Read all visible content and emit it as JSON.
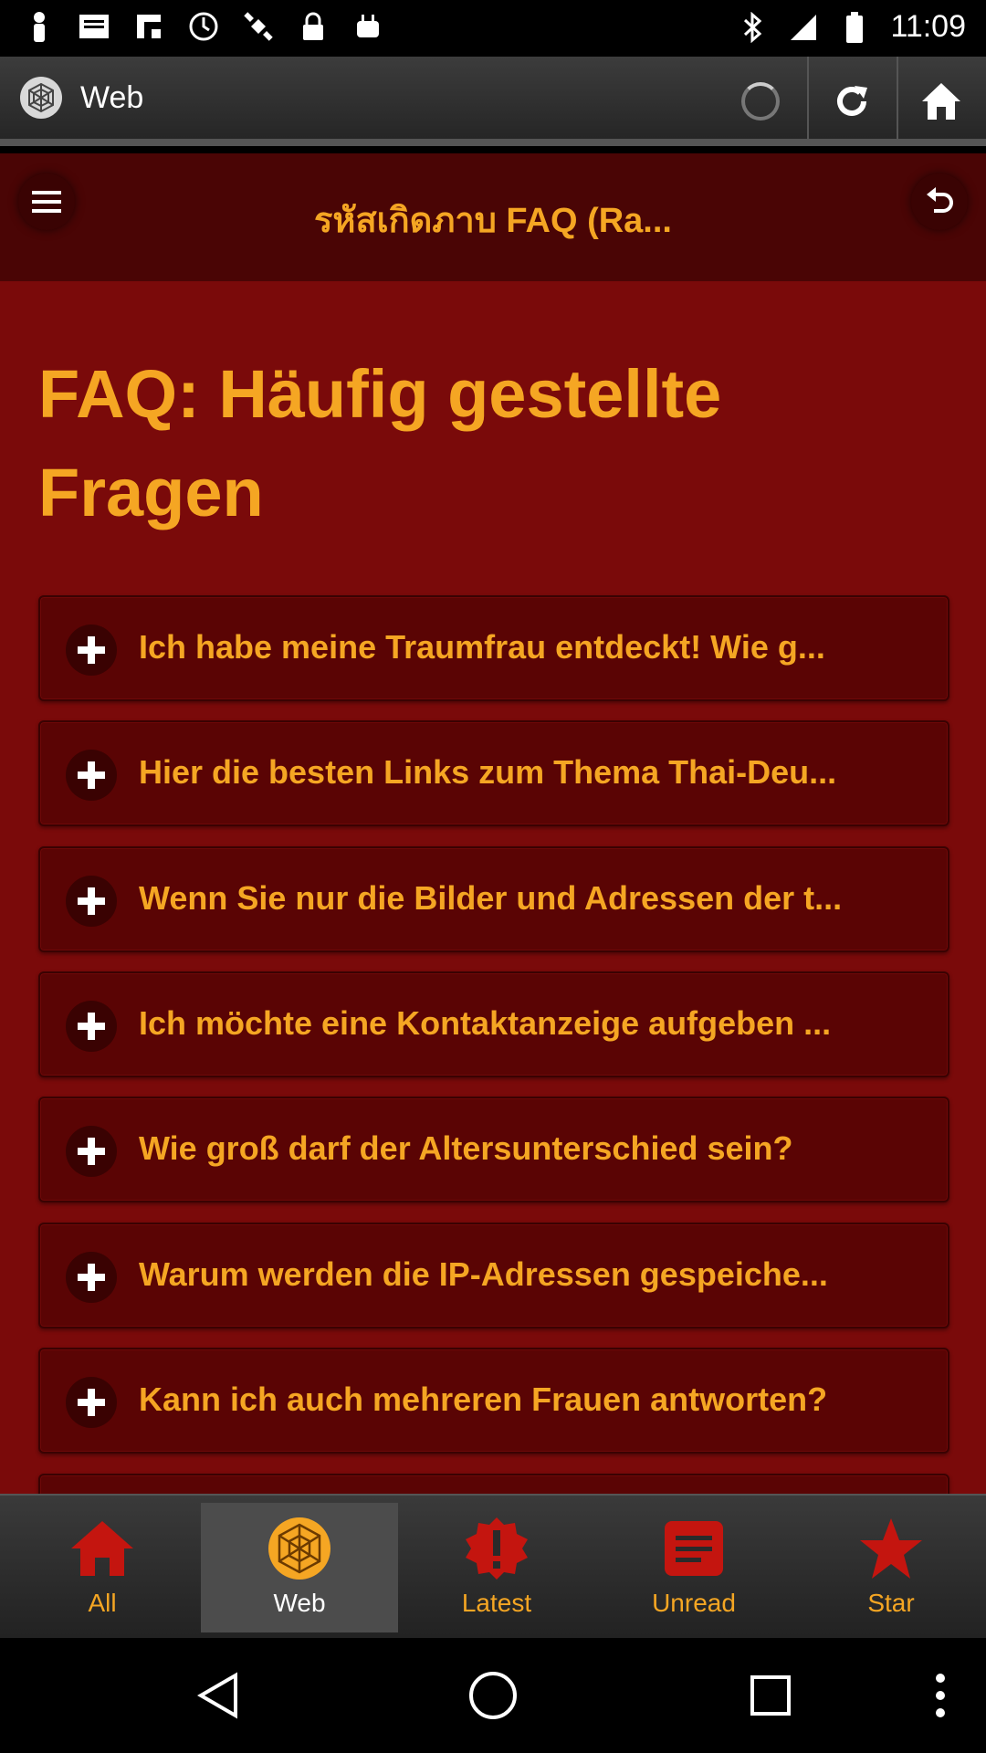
{
  "status_bar": {
    "time": "11:09",
    "left_icons": [
      "person-icon",
      "mail-icon",
      "flipboard-icon",
      "sync-icon",
      "satellite-icon",
      "lock-icon",
      "android-icon"
    ],
    "right_icons": [
      "bluetooth-icon",
      "signal-icon",
      "battery-icon"
    ]
  },
  "browser": {
    "title": "Web"
  },
  "page": {
    "header_title": "รหัสเกิดภาบ FAQ (Ra...",
    "heading": "FAQ: Häufig gestellte Fragen",
    "faq_items": [
      "Ich habe meine Traumfrau entdeckt! Wie g...",
      "Hier die besten Links zum Thema Thai-Deu...",
      "Wenn Sie nur die Bilder und Adressen der t...",
      "Ich möchte eine Kontaktanzeige aufgeben ...",
      "Wie groß darf der Altersunterschied sein?",
      "Warum werden die IP-Adressen gespeiche...",
      "Kann ich auch mehreren Frauen antworten?"
    ]
  },
  "tabs": [
    {
      "label": "All",
      "icon": "home-icon"
    },
    {
      "label": "Web",
      "icon": "web-icon"
    },
    {
      "label": "Latest",
      "icon": "alert-icon"
    },
    {
      "label": "Unread",
      "icon": "unread-icon"
    },
    {
      "label": "Star",
      "icon": "star-icon"
    }
  ],
  "colors": {
    "accent": "#f5a623",
    "page_background": "#7a0a0a",
    "header_background": "#4a0505",
    "item_background": "#5a0404",
    "tab_icon_red": "#c4150f"
  }
}
